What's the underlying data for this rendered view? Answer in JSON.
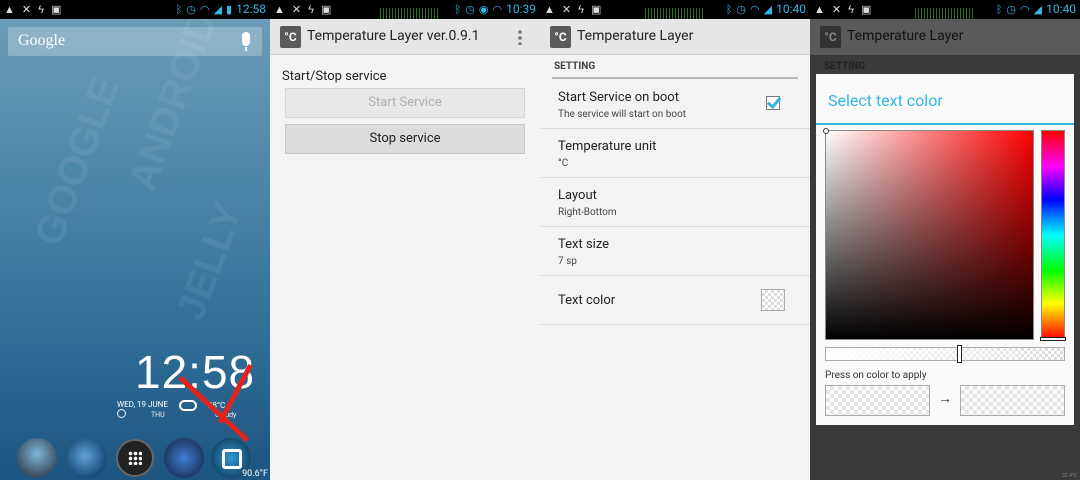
{
  "panel1": {
    "status": {
      "time": "12:58"
    },
    "search_label": "Google",
    "clock": "12:58",
    "date": "WED, 19 JUNE",
    "day": "THU",
    "temperature": "28°C",
    "condition": "Cloudy",
    "overlay_temp": "90.6°F",
    "wallpaper_words": [
      "GOOGLE",
      "ANDROID",
      "JELLY"
    ]
  },
  "panel2": {
    "status": {
      "time": "10:39"
    },
    "app_title": "Temperature Layer ver.0.9.1",
    "app_icon": "°C",
    "section": "Start/Stop service",
    "start_button": "Start Service",
    "stop_button": "Stop service"
  },
  "panel3": {
    "status": {
      "time": "10:40"
    },
    "app_title": "Temperature Layer",
    "app_icon": "°C",
    "category": "SETTING",
    "prefs": [
      {
        "title": "Start Service on boot",
        "summary": "The service will start on boot"
      },
      {
        "title": "Temperature unit",
        "summary": "°C"
      },
      {
        "title": "Layout",
        "summary": "Right-Bottom"
      },
      {
        "title": "Text size",
        "summary": "7 sp"
      },
      {
        "title": "Text color",
        "summary": ""
      }
    ]
  },
  "panel4": {
    "status": {
      "time": "10:40"
    },
    "app_title": "Temperature Layer",
    "app_icon": "°C",
    "category": "SETTING",
    "dialog_title": "Select text color",
    "apply_hint": "Press on color to apply",
    "arrow": "→",
    "tiny": "32.4°C"
  },
  "colors": {
    "accent": "#33b5e5",
    "arrow_red": "#e3231c"
  }
}
